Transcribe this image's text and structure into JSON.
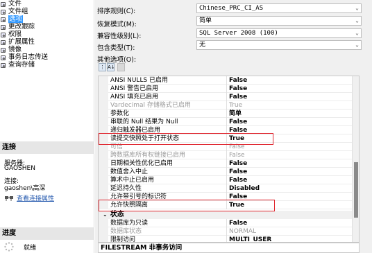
{
  "sidebar": {
    "items": [
      {
        "label": "文件"
      },
      {
        "label": "文件组"
      },
      {
        "label": "选项",
        "selected": true
      },
      {
        "label": "更改跟踪"
      },
      {
        "label": "权限"
      },
      {
        "label": "扩展属性"
      },
      {
        "label": "镜像"
      },
      {
        "label": "事务日志传送"
      },
      {
        "label": "查询存储"
      }
    ],
    "connection": {
      "header": "连接",
      "server_label": "服务器:",
      "server_value": "GAOSHEN",
      "conn_label": "连接:",
      "conn_value": "gaoshen\\高深",
      "view_props_link": "查看连接属性"
    },
    "progress": {
      "header": "进度",
      "status": "就绪"
    }
  },
  "form": {
    "collation_label": "排序规则(C):",
    "collation_value": "Chinese_PRC_CI_AS",
    "recovery_label": "恢复模式(M):",
    "recovery_value": "简单",
    "compat_label": "兼容性级别(L):",
    "compat_value": "SQL Server 2008 (100)",
    "containment_label": "包含类型(T):",
    "containment_value": "无",
    "other_label": "其他选项(O):"
  },
  "toolbar": {
    "categorized": "⋮",
    "alphabetical": "A↓",
    "pages": ""
  },
  "grid": {
    "rows": [
      {
        "name": "ANSI NULLS 已启用",
        "value": "False"
      },
      {
        "name": "ANSI 警告已启用",
        "value": "False"
      },
      {
        "name": "ANSI 填充已启用",
        "value": "False"
      },
      {
        "name": "Vardecimal 存储格式已启用",
        "value": "True",
        "dim": true
      },
      {
        "name": "参数化",
        "value": "简单"
      },
      {
        "name": "串联的 Null 结果为 Null",
        "value": "False"
      },
      {
        "name": "递归触发器已启用",
        "value": "False"
      },
      {
        "name": "读提交快照处于打开状态",
        "value": "True"
      },
      {
        "name": "可信",
        "value": "False",
        "dim": true
      },
      {
        "name": "跨数据库所有权链接已启用",
        "value": "False",
        "dim": true
      },
      {
        "name": "日期相关性优化已启用",
        "value": "False"
      },
      {
        "name": "数值舍入中止",
        "value": "False"
      },
      {
        "name": "算术中止已启用",
        "value": "False"
      },
      {
        "name": "延迟持久性",
        "value": "Disabled"
      },
      {
        "name": "允许带引号的标识符",
        "value": "False"
      },
      {
        "name": "允许快照隔离",
        "value": "True"
      }
    ],
    "category": "状态",
    "state_rows": [
      {
        "name": "数据库为只读",
        "value": "False"
      },
      {
        "name": "数据库状态",
        "value": "NORMAL",
        "dim": true
      },
      {
        "name": "限制访问",
        "value": "MULTI_USER"
      }
    ]
  },
  "description": "FILESTREAM 非事务访问",
  "colors": {
    "selection": "#3399ff",
    "highlight_box": "#e0262f",
    "link": "#2a5db0"
  }
}
